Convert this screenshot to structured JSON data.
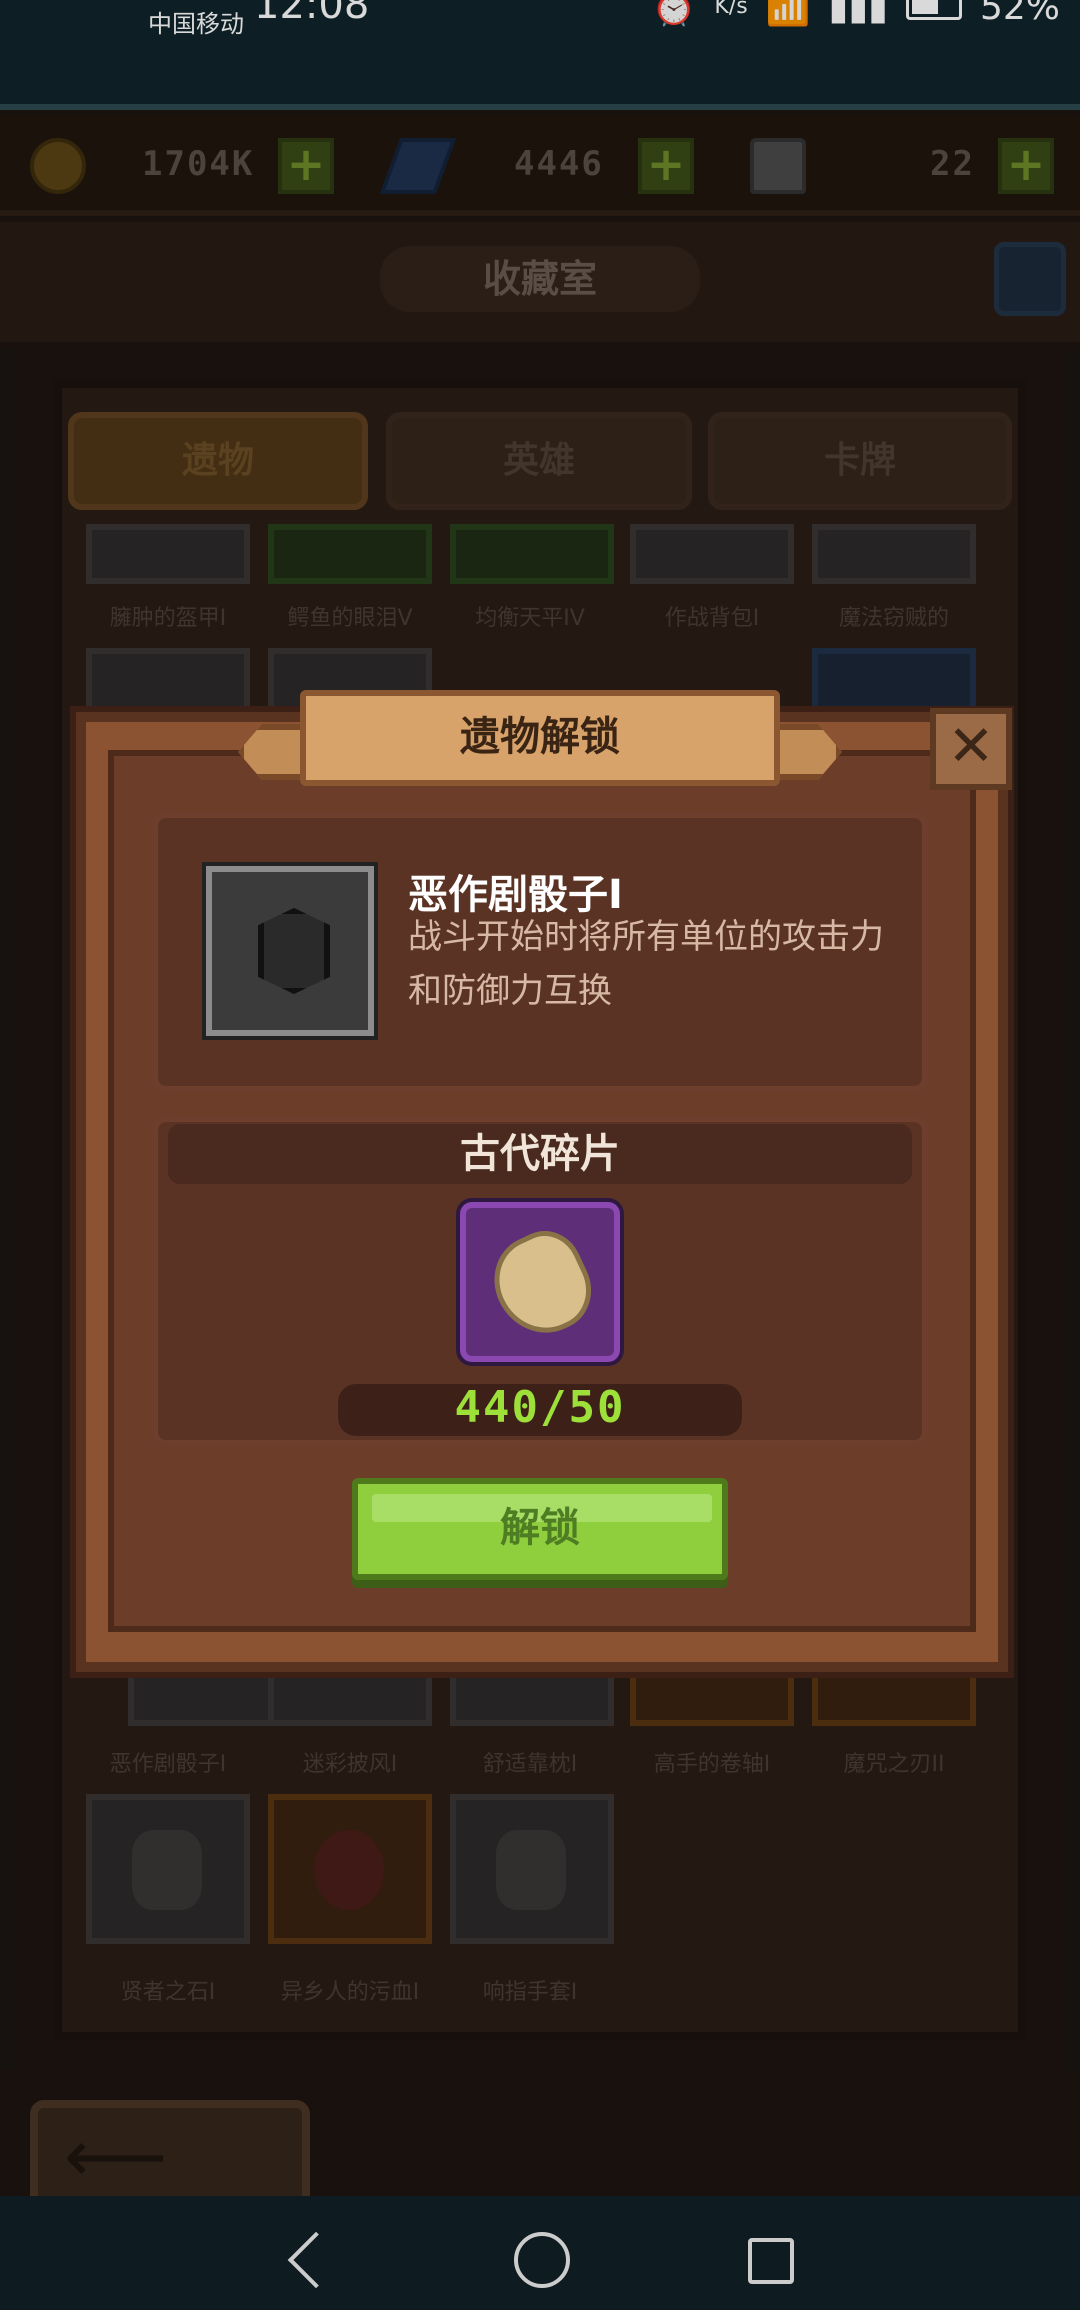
{
  "status_bar": {
    "carrier": "中国移动",
    "time": "12:08",
    "speed_unit": "K/s",
    "battery": "52%"
  },
  "resources": {
    "coins": "1704K",
    "gems": "4446",
    "potions": "22"
  },
  "header": {
    "title": "收藏室"
  },
  "tabs": [
    {
      "label": "遗物",
      "active": true
    },
    {
      "label": "英雄",
      "active": false
    },
    {
      "label": "卡牌",
      "active": false
    }
  ],
  "grid_items_row1": [
    "臃肿的盔甲I",
    "鳄鱼的眼泪V",
    "均衡天平IV",
    "作战背包I",
    "魔法窃贼的"
  ],
  "grid_items_row3": [
    "恶作剧骰子I",
    "迷彩披风I",
    "舒适靠枕I",
    "高手的卷轴I",
    "魔咒之刃II"
  ],
  "grid_items_row4": [
    "贤者之石I",
    "异乡人的污血I",
    "响指手套I"
  ],
  "modal": {
    "title": "遗物解锁",
    "relic_name": "恶作剧骰子I",
    "relic_description": "战斗开始时将所有单位的攻击力和防御力互换",
    "fragment_title": "古代碎片",
    "fragment_count": "440/50",
    "unlock_label": "解锁"
  }
}
